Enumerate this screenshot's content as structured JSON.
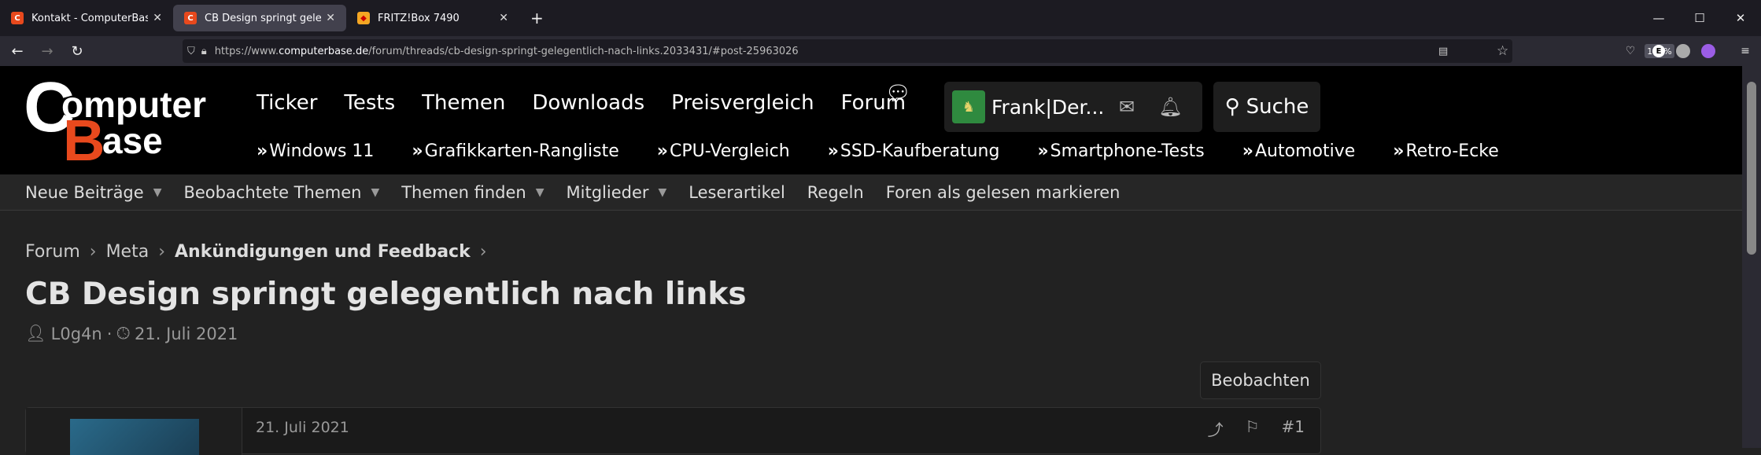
{
  "browser": {
    "tabs": [
      {
        "title": "Kontakt - ComputerBase",
        "icon": "computerbase-icon"
      },
      {
        "title": "CB Design springt gelegentlich",
        "icon": "computerbase-icon"
      },
      {
        "title": "FRITZ!Box 7490",
        "icon": "fritzbox-icon"
      }
    ],
    "new_tab": "+",
    "url_prefix": "https://www.",
    "url_host": "computerbase.de",
    "url_path": "/forum/threads/cb-design-springt-gelegentlich-nach-links.2033431/#post-25963026",
    "zoom": "170%"
  },
  "header": {
    "logo": {
      "c": "C",
      "omp": "omputer",
      "b": "B",
      "ase": "ase"
    },
    "nav": [
      "Ticker",
      "Tests",
      "Themen",
      "Downloads",
      "Preisvergleich",
      "Forum"
    ],
    "username": "Frank|Der...",
    "search_label": "Suche",
    "subnav": [
      "Windows 11",
      "Grafikkarten-Rangliste",
      "CPU-Vergleich",
      "SSD-Kaufberatung",
      "Smartphone-Tests",
      "Automotive",
      "Retro-Ecke"
    ]
  },
  "forum_nav": [
    "Neue Beiträge",
    "Beobachtete Themen",
    "Themen finden",
    "Mitglieder",
    "Leserartikel",
    "Regeln",
    "Foren als gelesen markieren"
  ],
  "breadcrumb": [
    "Forum",
    "Meta",
    "Ankündigungen und Feedback"
  ],
  "thread": {
    "title": "CB Design springt gelegentlich nach links",
    "author": "L0g4n",
    "date": "21. Juli 2021",
    "watch_button": "Beobachten"
  },
  "post": {
    "date": "21. Juli 2021",
    "number": "#1"
  }
}
